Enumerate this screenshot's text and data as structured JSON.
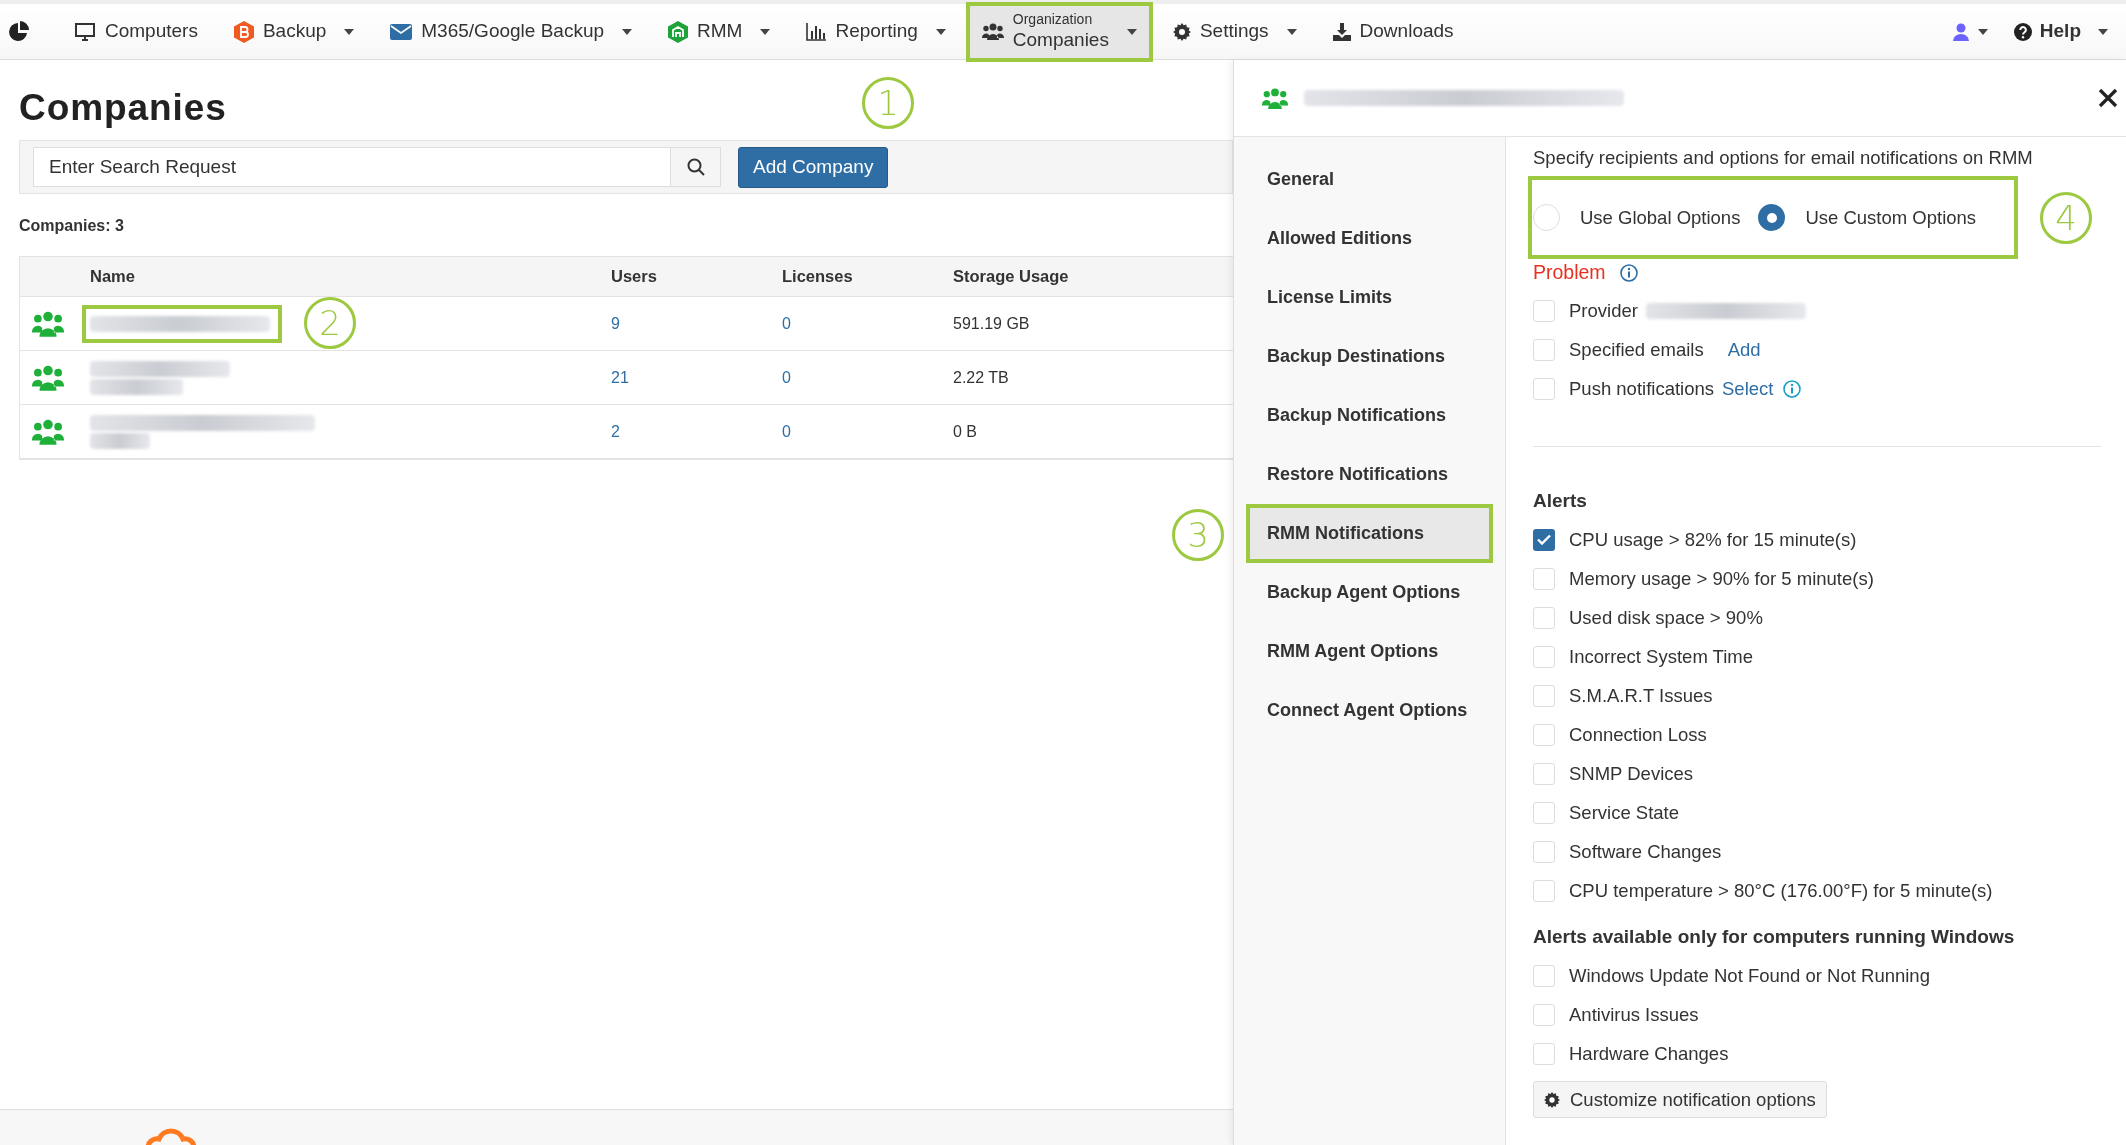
{
  "nav": {
    "items": [
      {
        "label": "Computers",
        "dropdown": false,
        "selected": false,
        "highlighted": false
      },
      {
        "label": "Backup",
        "dropdown": true,
        "selected": false,
        "highlighted": false
      },
      {
        "label": "M365/Google Backup",
        "dropdown": true,
        "selected": false,
        "highlighted": false
      },
      {
        "label": "RMM",
        "dropdown": true,
        "selected": false,
        "highlighted": false
      },
      {
        "label": "Reporting",
        "dropdown": true,
        "selected": false,
        "highlighted": false
      },
      {
        "sublabel": "Organization",
        "label": "Companies",
        "dropdown": true,
        "selected": true,
        "highlighted": true
      },
      {
        "label": "Settings",
        "dropdown": true,
        "selected": false,
        "highlighted": false
      },
      {
        "label": "Downloads",
        "dropdown": false,
        "selected": false,
        "highlighted": false
      }
    ],
    "help": {
      "label": "Help"
    }
  },
  "page": {
    "title": "Companies",
    "search": {
      "placeholder": "Enter Search Request"
    },
    "add_button": "Add Company",
    "count": "Companies: 3"
  },
  "table": {
    "columns": [
      "Name",
      "Users",
      "Licenses",
      "Storage Usage"
    ],
    "rows": [
      {
        "users": "9",
        "licenses": "0",
        "storage": "591.19 GB",
        "highlighted": true
      },
      {
        "users": "21",
        "licenses": "0",
        "storage": "2.22 TB",
        "highlighted": false
      },
      {
        "users": "2",
        "licenses": "0",
        "storage": "0 B",
        "highlighted": false
      }
    ]
  },
  "panel": {
    "side_nav": [
      {
        "label": "General",
        "selected": false,
        "highlighted": false
      },
      {
        "label": "Allowed Editions",
        "selected": false,
        "highlighted": false
      },
      {
        "label": "License Limits",
        "selected": false,
        "highlighted": false
      },
      {
        "label": "Backup Destinations",
        "selected": false,
        "highlighted": false
      },
      {
        "label": "Backup Notifications",
        "selected": false,
        "highlighted": false
      },
      {
        "label": "Restore Notifications",
        "selected": false,
        "highlighted": false
      },
      {
        "label": "RMM Notifications",
        "selected": true,
        "highlighted": true
      },
      {
        "label": "Backup Agent Options",
        "selected": false,
        "highlighted": false
      },
      {
        "label": "RMM Agent Options",
        "selected": false,
        "highlighted": false
      },
      {
        "label": "Connect Agent Options",
        "selected": false,
        "highlighted": false
      }
    ],
    "description": "Specify recipients and options for email notifications on RMM",
    "options_highlighted": true,
    "options": [
      {
        "label": "Use Global Options",
        "selected": false
      },
      {
        "label": "Use Custom Options",
        "selected": true
      }
    ],
    "problem_title": "Problem",
    "recipients": [
      {
        "kind": "provider",
        "label": "Provider",
        "checked": false
      },
      {
        "kind": "link",
        "label": "Specified emails",
        "checked": false,
        "link": "Add"
      },
      {
        "kind": "link_info",
        "label": "Push notifications",
        "checked": false,
        "link": "Select"
      }
    ],
    "alerts_title": "Alerts",
    "alerts": [
      {
        "label": "CPU usage > 82% for 15 minute(s)",
        "checked": true
      },
      {
        "label": "Memory usage > 90% for 5 minute(s)",
        "checked": false
      },
      {
        "label": "Used disk space > 90%",
        "checked": false
      },
      {
        "label": "Incorrect System Time",
        "checked": false
      },
      {
        "label": "S.M.A.R.T Issues",
        "checked": false
      },
      {
        "label": "Connection Loss",
        "checked": false
      },
      {
        "label": "SNMP Devices",
        "checked": false
      },
      {
        "label": "Service State",
        "checked": false
      },
      {
        "label": "Software Changes",
        "checked": false
      },
      {
        "label": "CPU temperature > 80°C (176.00°F) for 5 minute(s)",
        "checked": false
      }
    ],
    "windows_title": "Alerts available only for computers running Windows",
    "windows_alerts": [
      {
        "label": "Windows Update Not Found or Not Running",
        "checked": false
      },
      {
        "label": "Antivirus Issues",
        "checked": false
      },
      {
        "label": "Hardware Changes",
        "checked": false
      }
    ],
    "customize_button": "Customize notification options"
  },
  "callouts": [
    {
      "number": "1"
    },
    {
      "number": "2"
    },
    {
      "number": "3"
    },
    {
      "number": "4"
    }
  ]
}
